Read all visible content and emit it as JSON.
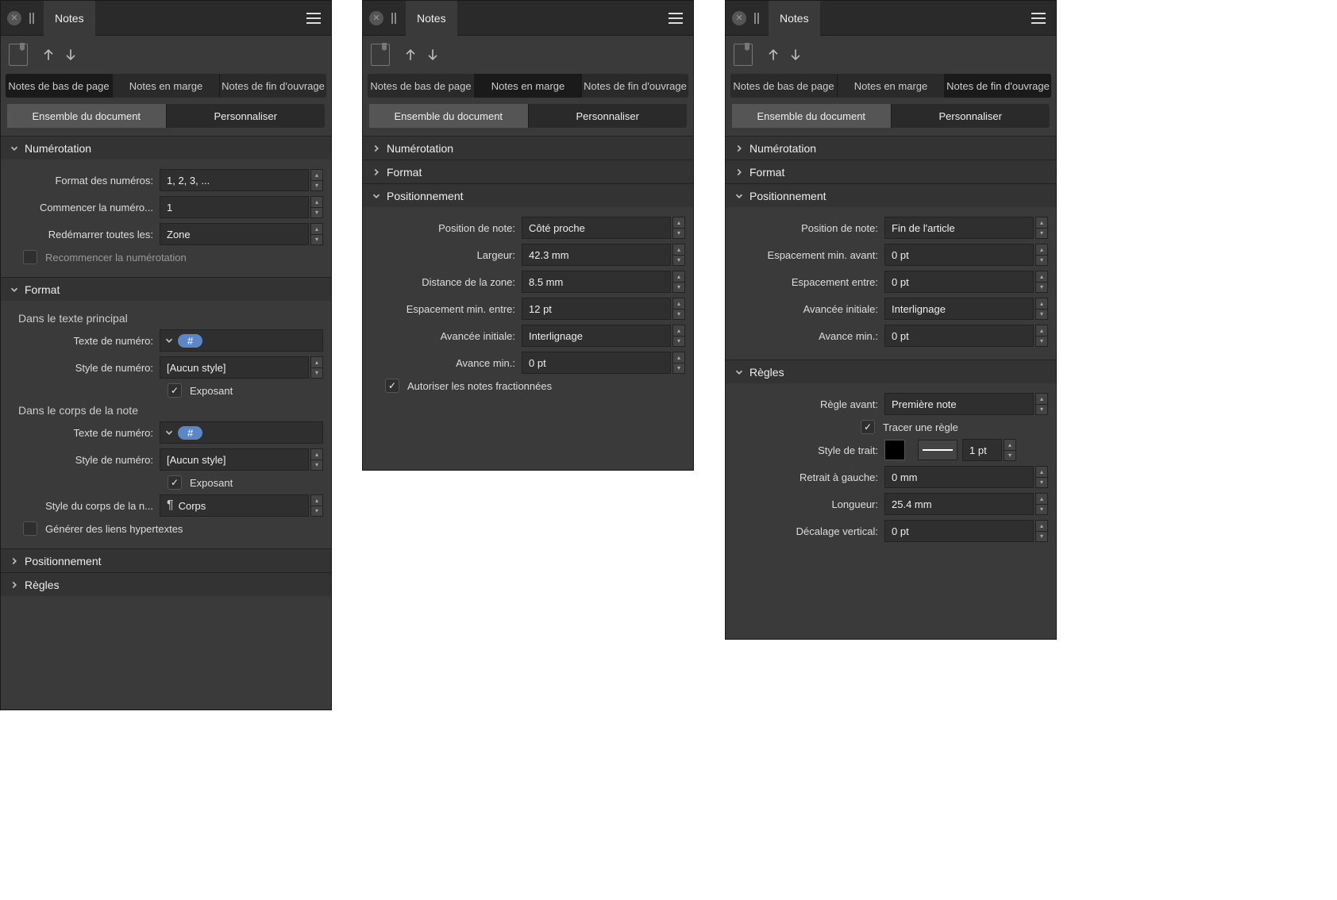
{
  "panels": [
    "p1",
    "p2",
    "p3"
  ],
  "common": {
    "title": "Notes",
    "subtabs": [
      "Notes de bas de page",
      "Notes en marge",
      "Notes de fin d'ouvrage"
    ],
    "seg": [
      "Ensemble du document",
      "Personnaliser"
    ]
  },
  "p1": {
    "sections": {
      "numerotation": {
        "label": "Numérotation",
        "format_numeros_label": "Format des numéros:",
        "format_numeros_value": "1, 2, 3, ...",
        "commencer_label": "Commencer la numéro...",
        "commencer_value": "1",
        "redemarrer_label": "Redémarrer toutes les:",
        "redemarrer_value": "Zone",
        "recommencer_label": "Recommencer la numérotation"
      },
      "format": {
        "label": "Format",
        "sub_main": "Dans le texte principal",
        "sub_body": "Dans le corps de la note",
        "texte_numero_label": "Texte de numéro:",
        "texte_numero_pill": "#",
        "style_numero_label": "Style de numéro:",
        "style_numero_value": "[Aucun style]",
        "exposant_label": "Exposant",
        "style_corps_label": "Style du corps de la n...",
        "style_corps_value": "Corps",
        "hyperliens_label": "Générer des liens hypertextes"
      },
      "positionnement": {
        "label": "Positionnement"
      },
      "regles": {
        "label": "Règles"
      }
    }
  },
  "p2": {
    "sections": {
      "numerotation": {
        "label": "Numérotation"
      },
      "format": {
        "label": "Format"
      },
      "positionnement": {
        "label": "Positionnement",
        "position_label": "Position de note:",
        "position_value": "Côté proche",
        "largeur_label": "Largeur:",
        "largeur_value": "42.3 mm",
        "distance_label": "Distance de la zone:",
        "distance_value": "8.5 mm",
        "espacement_label": "Espacement min. entre:",
        "espacement_value": "12 pt",
        "avancee_label": "Avancée initiale:",
        "avancee_value": "Interlignage",
        "avance_min_label": "Avance min.:",
        "avance_min_value": "0 pt",
        "fractionnees_label": "Autoriser les notes fractionnées"
      }
    }
  },
  "p3": {
    "sections": {
      "numerotation": {
        "label": "Numérotation"
      },
      "format": {
        "label": "Format"
      },
      "positionnement": {
        "label": "Positionnement",
        "position_label": "Position de note:",
        "position_value": "Fin de l'article",
        "esp_avant_label": "Espacement min. avant:",
        "esp_avant_value": "0 pt",
        "esp_entre_label": "Espacement entre:",
        "esp_entre_value": "0 pt",
        "avancee_label": "Avancée initiale:",
        "avancee_value": "Interlignage",
        "avance_min_label": "Avance min.:",
        "avance_min_value": "0 pt"
      },
      "regles": {
        "label": "Règles",
        "regle_avant_label": "Règle avant:",
        "regle_avant_value": "Première note",
        "tracer_label": "Tracer une règle",
        "style_trait_label": "Style de trait:",
        "style_trait_value": "1 pt",
        "retrait_label": "Retrait à gauche:",
        "retrait_value": "0 mm",
        "longueur_label": "Longueur:",
        "longueur_value": "25.4 mm",
        "decalage_label": "Décalage vertical:",
        "decalage_value": "0 pt"
      }
    }
  }
}
